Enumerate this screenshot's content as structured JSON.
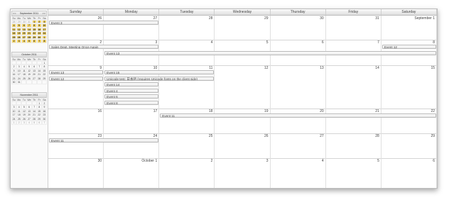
{
  "mini_calendars": [
    {
      "title": "September 2011",
      "prev": "<<",
      "next": ">>",
      "day_names": [
        "Su",
        "Mo",
        "Tu",
        "We",
        "Th",
        "Fr",
        "Sa"
      ],
      "days": [
        {
          "t": "28",
          "c": "other"
        },
        {
          "t": "29",
          "c": "other"
        },
        {
          "t": "30",
          "c": "other"
        },
        {
          "t": "31",
          "c": "other"
        },
        {
          "t": "1",
          "c": "hl"
        },
        {
          "t": "2",
          "c": "hl"
        },
        {
          "t": "3",
          "c": "hl"
        },
        {
          "t": "4",
          "c": "hl"
        },
        {
          "t": "5",
          "c": "hl"
        },
        {
          "t": "6",
          "c": "hl"
        },
        {
          "t": "7",
          "c": "hl"
        },
        {
          "t": "8",
          "c": "hl"
        },
        {
          "t": "9",
          "c": "hl"
        },
        {
          "t": "10",
          "c": "hl"
        },
        {
          "t": "11",
          "c": "hl"
        },
        {
          "t": "12",
          "c": "hl"
        },
        {
          "t": "13",
          "c": "hl"
        },
        {
          "t": "14",
          "c": "hl"
        },
        {
          "t": "15",
          "c": "hl"
        },
        {
          "t": "16",
          "c": "hl"
        },
        {
          "t": "17",
          "c": "hl"
        },
        {
          "t": "18",
          "c": "hl"
        },
        {
          "t": "19",
          "c": "hl"
        },
        {
          "t": "20",
          "c": "hl"
        },
        {
          "t": "21",
          "c": "hl"
        },
        {
          "t": "22",
          "c": "hl"
        },
        {
          "t": "23",
          "c": "hl"
        },
        {
          "t": "24",
          "c": "hl"
        },
        {
          "t": "25",
          "c": "hl"
        },
        {
          "t": "26",
          "c": "hl"
        },
        {
          "t": "27",
          "c": "hl"
        },
        {
          "t": "28",
          "c": "hl"
        },
        {
          "t": "29",
          "c": "hl"
        },
        {
          "t": "30",
          "c": "hl"
        },
        {
          "t": "1",
          "c": "hl"
        },
        {
          "t": "2",
          "c": "hl"
        },
        {
          "t": "3",
          "c": "hl"
        },
        {
          "t": "4",
          "c": "hl"
        },
        {
          "t": "5",
          "c": "hl"
        },
        {
          "t": "6",
          "c": "hl"
        },
        {
          "t": "7",
          "c": "hl"
        },
        {
          "t": "8",
          "c": "hl"
        }
      ]
    },
    {
      "title": "October 2011",
      "day_names": [
        "Su",
        "Mo",
        "Tu",
        "We",
        "Th",
        "Fr",
        "Sa"
      ],
      "days": [
        {
          "t": "",
          "c": ""
        },
        {
          "t": "",
          "c": ""
        },
        {
          "t": "",
          "c": ""
        },
        {
          "t": "",
          "c": ""
        },
        {
          "t": "",
          "c": ""
        },
        {
          "t": "",
          "c": ""
        },
        {
          "t": "1",
          "c": ""
        },
        {
          "t": "2",
          "c": ""
        },
        {
          "t": "3",
          "c": ""
        },
        {
          "t": "4",
          "c": ""
        },
        {
          "t": "5",
          "c": ""
        },
        {
          "t": "6",
          "c": ""
        },
        {
          "t": "7",
          "c": ""
        },
        {
          "t": "8",
          "c": ""
        },
        {
          "t": "9",
          "c": ""
        },
        {
          "t": "10",
          "c": ""
        },
        {
          "t": "11",
          "c": ""
        },
        {
          "t": "12",
          "c": ""
        },
        {
          "t": "13",
          "c": ""
        },
        {
          "t": "14",
          "c": ""
        },
        {
          "t": "15",
          "c": ""
        },
        {
          "t": "16",
          "c": ""
        },
        {
          "t": "17",
          "c": ""
        },
        {
          "t": "18",
          "c": ""
        },
        {
          "t": "19",
          "c": ""
        },
        {
          "t": "20",
          "c": ""
        },
        {
          "t": "21",
          "c": ""
        },
        {
          "t": "22",
          "c": ""
        },
        {
          "t": "23",
          "c": ""
        },
        {
          "t": "24",
          "c": ""
        },
        {
          "t": "25",
          "c": ""
        },
        {
          "t": "26",
          "c": ""
        },
        {
          "t": "27",
          "c": ""
        },
        {
          "t": "28",
          "c": ""
        },
        {
          "t": "29",
          "c": ""
        },
        {
          "t": "30",
          "c": ""
        },
        {
          "t": "31",
          "c": ""
        },
        {
          "t": "",
          "c": ""
        },
        {
          "t": "",
          "c": ""
        },
        {
          "t": "",
          "c": ""
        },
        {
          "t": "",
          "c": ""
        },
        {
          "t": "",
          "c": ""
        }
      ]
    },
    {
      "title": "November 2011",
      "day_names": [
        "Su",
        "Mo",
        "Tu",
        "We",
        "Th",
        "Fr",
        "Sa"
      ],
      "days": [
        {
          "t": "",
          "c": ""
        },
        {
          "t": "",
          "c": ""
        },
        {
          "t": "",
          "c": ""
        },
        {
          "t": "",
          "c": ""
        },
        {
          "t": "",
          "c": ""
        },
        {
          "t": "1",
          "c": ""
        },
        {
          "t": "2",
          "c": ""
        },
        {
          "t": "3",
          "c": ""
        },
        {
          "t": "4",
          "c": ""
        },
        {
          "t": "5",
          "c": ""
        },
        {
          "t": "6",
          "c": ""
        },
        {
          "t": "7",
          "c": ""
        },
        {
          "t": "8",
          "c": ""
        },
        {
          "t": "9",
          "c": ""
        },
        {
          "t": "10",
          "c": ""
        },
        {
          "t": "11",
          "c": ""
        },
        {
          "t": "12",
          "c": ""
        },
        {
          "t": "13",
          "c": ""
        },
        {
          "t": "14",
          "c": ""
        },
        {
          "t": "15",
          "c": ""
        },
        {
          "t": "16",
          "c": ""
        },
        {
          "t": "17",
          "c": ""
        },
        {
          "t": "18",
          "c": ""
        },
        {
          "t": "19",
          "c": ""
        },
        {
          "t": "20",
          "c": ""
        },
        {
          "t": "21",
          "c": ""
        },
        {
          "t": "22",
          "c": ""
        },
        {
          "t": "23",
          "c": ""
        },
        {
          "t": "24",
          "c": ""
        },
        {
          "t": "25",
          "c": ""
        },
        {
          "t": "26",
          "c": ""
        },
        {
          "t": "27",
          "c": ""
        },
        {
          "t": "28",
          "c": ""
        },
        {
          "t": "29",
          "c": ""
        },
        {
          "t": "30",
          "c": ""
        },
        {
          "t": "1",
          "c": "other"
        },
        {
          "t": "2",
          "c": "other"
        },
        {
          "t": "3",
          "c": "other"
        },
        {
          "t": "4",
          "c": "other"
        },
        {
          "t": "5",
          "c": "other"
        },
        {
          "t": "6",
          "c": "other"
        },
        {
          "t": "7",
          "c": "other"
        }
      ]
    }
  ],
  "day_headers": [
    "Sunday",
    "Monday",
    "Tuesday",
    "Wednesday",
    "Thursday",
    "Friday",
    "Saturday"
  ],
  "weeks": [
    {
      "dates": [
        "26",
        "27",
        "28",
        "29",
        "30",
        "31",
        "September 1"
      ],
      "events": [
        {
          "label": "Event 3",
          "start": 0,
          "span": 2,
          "row": 0
        }
      ]
    },
    {
      "dates": [
        "2",
        "3",
        "4",
        "5",
        "6",
        "7",
        "8"
      ],
      "events": [
        {
          "label": "Sales Dept. Meeting Once Again",
          "start": 0,
          "span": 2,
          "row": 0
        },
        {
          "label": "Event 12",
          "start": 6,
          "span": 1,
          "row": 0
        },
        {
          "label": "Event 13",
          "start": 1,
          "span": 6,
          "row": 1
        }
      ]
    },
    {
      "dates": [
        "9",
        "10",
        "11",
        "12",
        "13",
        "14",
        "15"
      ],
      "events": [
        {
          "label": "Event 13",
          "start": 0,
          "span": 1,
          "row": 0
        },
        {
          "label": "Event 15",
          "start": 1,
          "span": 2,
          "row": 0
        },
        {
          "label": "Event 12",
          "start": 0,
          "span": 1,
          "row": 1
        },
        {
          "label": "Unicode test: 日本語 (requires Unicode fonts on the client side)",
          "start": 1,
          "span": 2,
          "row": 1
        },
        {
          "label": "Event 14",
          "start": 1,
          "span": 1,
          "row": 2
        },
        {
          "label": "Event 4",
          "start": 1,
          "span": 1,
          "row": 3
        },
        {
          "label": "Event 6",
          "start": 1,
          "span": 1,
          "row": 4
        },
        {
          "label": "Event 8",
          "start": 1,
          "span": 1,
          "row": 5
        }
      ]
    },
    {
      "dates": [
        "16",
        "17",
        "18",
        "19",
        "20",
        "21",
        "22"
      ],
      "events": [
        {
          "label": "Event 11",
          "start": 2,
          "span": 5,
          "row": 0
        }
      ]
    },
    {
      "dates": [
        "23",
        "24",
        "25",
        "26",
        "27",
        "28",
        "29"
      ],
      "events": [
        {
          "label": "Event 11",
          "start": 0,
          "span": 2,
          "row": 0
        }
      ]
    },
    {
      "dates": [
        "30",
        "October 1",
        "2",
        "3",
        "4",
        "5",
        "6"
      ],
      "events": []
    }
  ]
}
